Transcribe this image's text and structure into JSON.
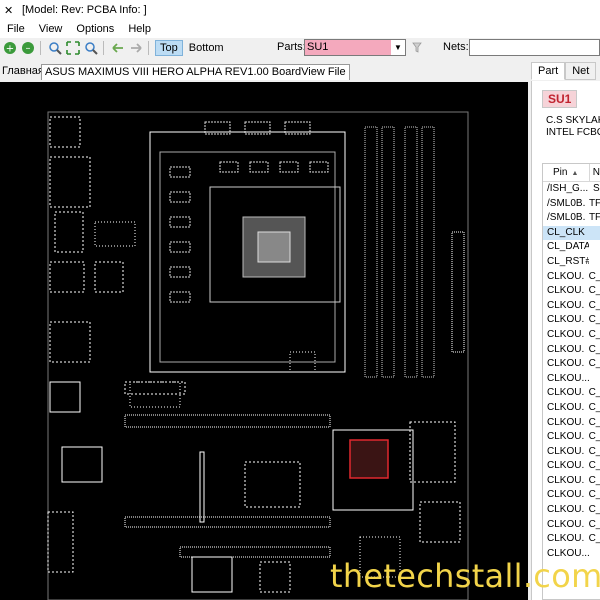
{
  "window": {
    "title": "[Model: Rev:  PCBA Info: ]"
  },
  "menu": [
    "File",
    "View",
    "Options",
    "Help"
  ],
  "toolbar": {
    "icons": [
      "zoom-in-icon",
      "zoom-out-icon",
      "zoom-area-icon",
      "fit-icon",
      "zoom-out-small-icon",
      "arrow-left-icon",
      "arrow-right-icon"
    ],
    "top_label": "Top",
    "bottom_label": "Bottom",
    "parts_label": "Parts:",
    "parts_value": "SU1",
    "nets_label": "Nets:",
    "nets_value": ""
  },
  "tabs": {
    "home": "Главная",
    "board": "ASUS MAXIMUS VIII HERO ALPHA REV1.00 BoardView File"
  },
  "panel": {
    "tabs": [
      "Part",
      "Net"
    ],
    "part_name": "SU1",
    "desc_line1": "C.S SKYLAKE",
    "desc_line2": "INTEL FCBGA",
    "columns": [
      "Pin",
      "N"
    ],
    "rows": [
      [
        "/ISH_G...",
        "S"
      ],
      [
        "/SML0B...",
        "TF"
      ],
      [
        "/SML0B...",
        "TF"
      ],
      [
        "CL_CLK",
        ""
      ],
      [
        "CL_DATA",
        ""
      ],
      [
        "CL_RST#",
        ""
      ],
      [
        "CLKOU...",
        "C_"
      ],
      [
        "CLKOU...",
        "C_"
      ],
      [
        "CLKOU...",
        "C_"
      ],
      [
        "CLKOU...",
        "C_"
      ],
      [
        "CLKOU...",
        "C_"
      ],
      [
        "CLKOU...",
        "C_"
      ],
      [
        "CLKOU...",
        "C_"
      ],
      [
        "CLKOU...",
        ""
      ],
      [
        "CLKOU...",
        "C_"
      ],
      [
        "CLKOU...",
        "C_"
      ],
      [
        "CLKOU...",
        "C_"
      ],
      [
        "CLKOU...",
        "C_"
      ],
      [
        "CLKOU...",
        "C_"
      ],
      [
        "CLKOU...",
        "C_"
      ],
      [
        "CLKOU...",
        "C_"
      ],
      [
        "CLKOU...",
        "C_"
      ],
      [
        "CLKOU...",
        "C_"
      ],
      [
        "CLKOU...",
        "C_"
      ],
      [
        "CLKOU...",
        "C_"
      ],
      [
        "CLKOU...",
        ""
      ]
    ],
    "selected_row": 3
  },
  "watermark": "thetechstall.com",
  "colors": {
    "board_bg": "#000000",
    "trace": "#ffffff",
    "highlight": "#e0282e",
    "watermark": "#f2d44a"
  }
}
